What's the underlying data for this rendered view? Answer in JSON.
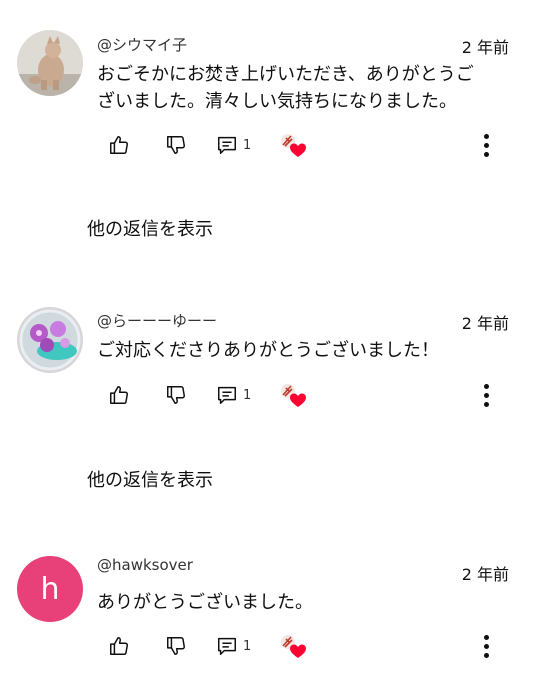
{
  "comments": [
    {
      "author": "@シウマイ子",
      "time": "2 年前",
      "text_lines": [
        "おごそかにお焚き上げいただき、ありがとうご",
        "ざいました。清々しい気持ちになりました。"
      ],
      "reply_count": "1",
      "avatar": "photo-cat-figure"
    },
    {
      "author": "@らーーーゆーー",
      "time": "2 年前",
      "text_lines": [
        "ご対応くださりありがとうございました！"
      ],
      "reply_count": "1",
      "avatar": "photo-flower-sphere"
    },
    {
      "author": "@hawksover",
      "time": "2 年前",
      "text_lines": [
        "ありがとうございました。"
      ],
      "reply_count": "1",
      "avatar_letter": "h",
      "avatar_color": "#e8417a"
    }
  ],
  "show_replies_label": "他の返信を表示",
  "icons": [
    "like-icon",
    "dislike-icon",
    "reply-icon",
    "creator-heart-icon",
    "more-vert-icon"
  ]
}
